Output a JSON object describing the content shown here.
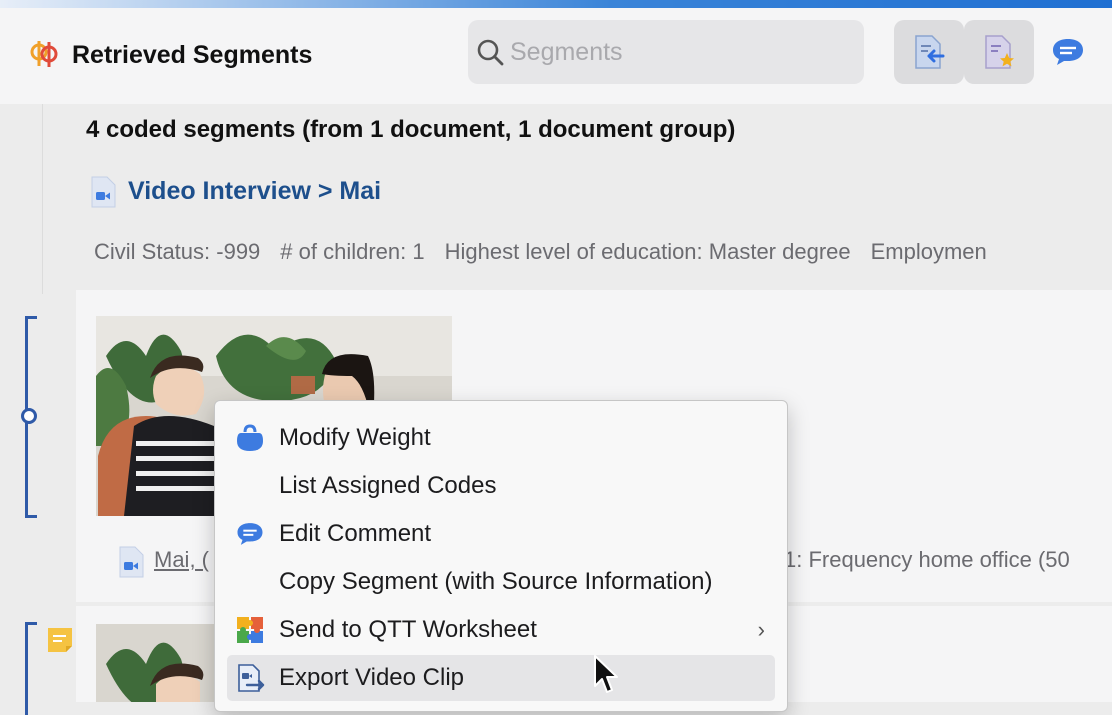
{
  "header": {
    "title": "Retrieved Segments",
    "search_placeholder": "Segments"
  },
  "summary": "4 coded segments (from 1 document, 1 document group)",
  "document": {
    "title": "Video Interview > Mai",
    "variables": [
      "Civil Status: -999",
      "# of children: 1",
      "Highest level of education: Master degree",
      "Employmen"
    ]
  },
  "segment": {
    "source_link": "Mai, (",
    "source_tail": "1: Frequency home office (50"
  },
  "context_menu": {
    "items": [
      {
        "label": "Modify Weight",
        "icon": "weight-icon"
      },
      {
        "label": "List Assigned Codes",
        "icon": ""
      },
      {
        "label": "Edit Comment",
        "icon": "comment-icon"
      },
      {
        "label": "Copy Segment (with Source Information)",
        "icon": ""
      },
      {
        "label": "Send to QTT Worksheet",
        "icon": "puzzle-icon",
        "submenu": true
      },
      {
        "label": "Export Video Clip",
        "icon": "export-video-icon",
        "highlighted": true
      }
    ]
  },
  "colors": {
    "accent": "#2f5aa8",
    "doc_title": "#1d4f8c",
    "blue_icon": "#3d7be0"
  }
}
